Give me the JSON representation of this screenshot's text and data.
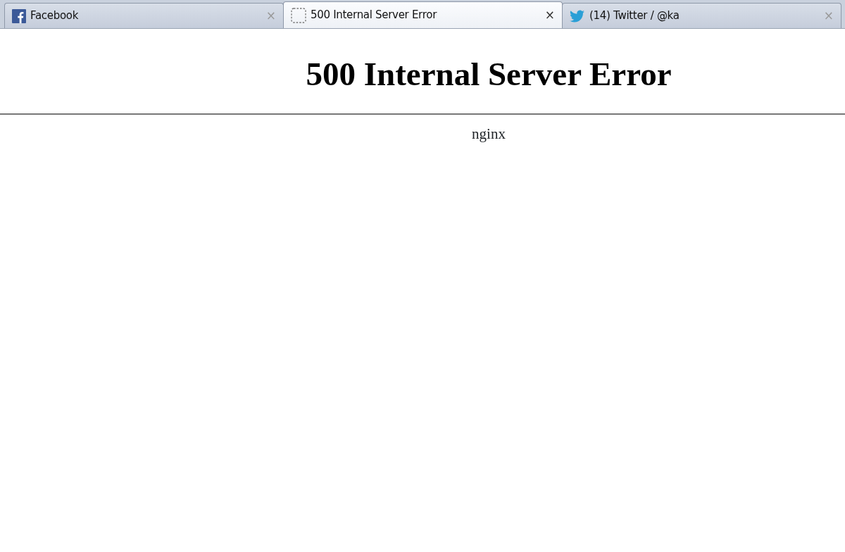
{
  "tabs": [
    {
      "kind": "facebook",
      "title": "Facebook",
      "close": "×",
      "selected": false
    },
    {
      "kind": "blank",
      "title": "500 Internal Server Error",
      "close": "×",
      "selected": true
    },
    {
      "kind": "bird",
      "title": "(14) Twitter / @ka",
      "close": "×",
      "selected": false
    }
  ],
  "page": {
    "heading": "500 Internal Server Error",
    "footer": "nginx"
  }
}
